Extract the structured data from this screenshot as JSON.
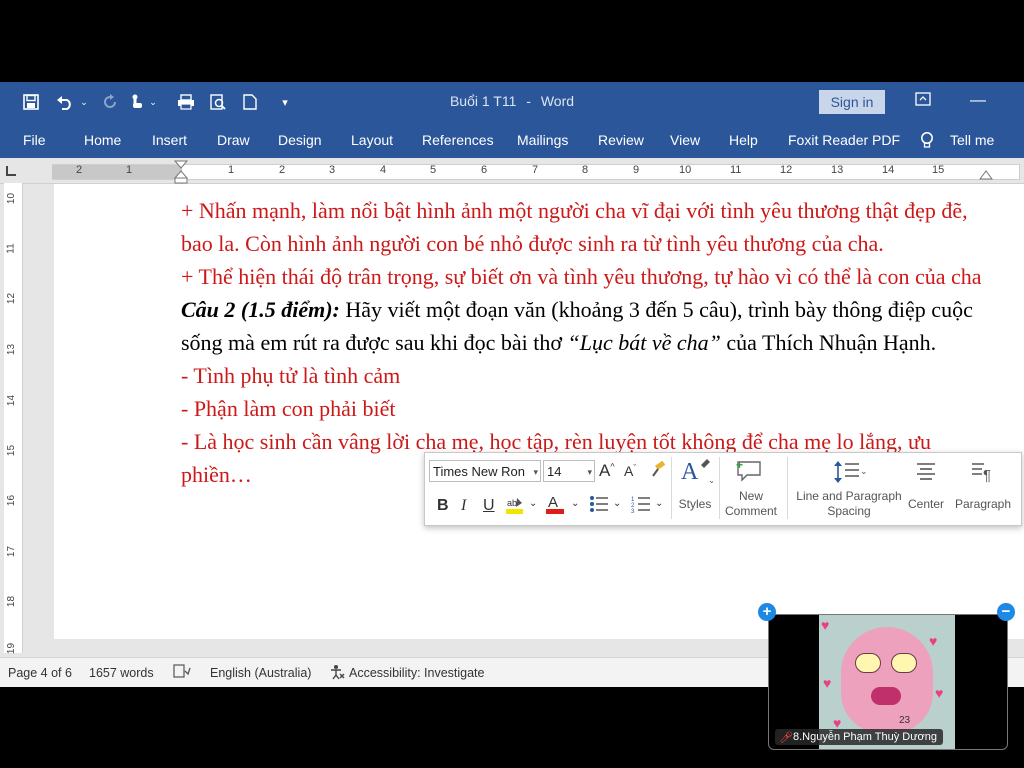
{
  "app": {
    "document_title": "Buổi 1 T11",
    "app_name": "Word",
    "separator": "-",
    "sign_in_label": "Sign in"
  },
  "quick_access": {
    "save_icon": "save-icon",
    "undo_icon": "undo-icon",
    "redo_icon": "redo-icon",
    "touch_mode_icon": "touch-mode-icon",
    "print_icon": "print-icon",
    "print_preview_icon": "print-preview-icon",
    "new_doc_icon": "new-document-icon",
    "customize_icon": "customize-qat-icon"
  },
  "ribbon_tabs": [
    "File",
    "Home",
    "Insert",
    "Draw",
    "Design",
    "Layout",
    "References",
    "Mailings",
    "Review",
    "View",
    "Help",
    "Foxit Reader PDF",
    "Tell me"
  ],
  "ruler": {
    "h_marks": [
      "2",
      "1",
      "1",
      "2",
      "3",
      "4",
      "5",
      "6",
      "7",
      "8",
      "9",
      "10",
      "11",
      "12",
      "13",
      "14",
      "15"
    ],
    "v_marks": [
      "10",
      "11",
      "12",
      "13",
      "14",
      "15",
      "16",
      "17",
      "18",
      "19"
    ]
  },
  "document": {
    "lines": [
      {
        "style": "red",
        "text": "+ Nhấn mạnh, làm nổi bật hình ảnh một người cha vĩ đại với tình yêu thương thật đẹp đẽ, bao la. Còn hình ảnh người con bé nhỏ được sinh ra từ tình yêu thương của cha."
      },
      {
        "style": "red",
        "text": "+ Thể hiện thái độ trân trọng, sự biết ơn và tình yêu thương, tự hào vì có thể là con của cha"
      }
    ],
    "question": {
      "label": "Câu 2 (1.5 điểm):",
      "text_before": " Hãy viết một đoạn văn (khoảng 3 đến 5 câu), trình bày thông điệp cuộc sống mà em rút ra được sau khi đọc bài thơ ",
      "poem": "“Lục bát về cha”",
      "text_after": " của Thích Nhuận Hạnh."
    },
    "answers": [
      "- Tình phụ tử là tình cảm",
      "- Phận làm con phải biết",
      "- Là học sinh cần vâng lời cha mẹ, học tập, rèn luyện tốt không để cha mẹ lo lắng, ưu phiền…"
    ]
  },
  "mini_toolbar": {
    "font_name": "Times New Ron",
    "font_size": "14",
    "styles_label": "Styles",
    "new_comment_label_1": "New",
    "new_comment_label_2": "Comment",
    "spacing_label_1": "Line and Paragraph",
    "spacing_label_2": "Spacing",
    "center_label": "Center",
    "paragraph_label": "Paragraph"
  },
  "status_bar": {
    "page": "Page 4 of 6",
    "words": "1657 words",
    "language": "English (Australia)",
    "accessibility": "Accessibility: Investigate"
  },
  "video": {
    "participant_name": "8.Nguyễn Phạm Thuỳ Dương",
    "overlay_number": "23"
  },
  "colors": {
    "word_blue": "#2b579a",
    "red_text": "#cc1818",
    "video_control": "#1e88e5"
  }
}
